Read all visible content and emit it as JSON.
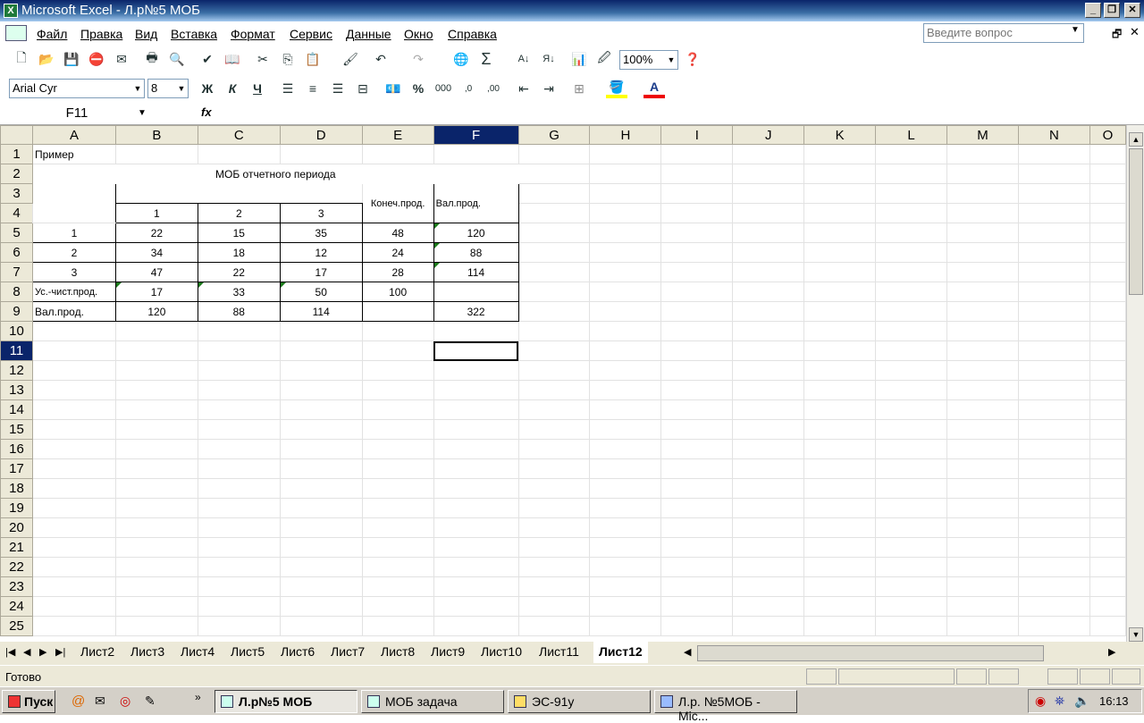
{
  "window": {
    "title": "Microsoft Excel - Л.р№5 МОБ"
  },
  "menu": {
    "items": [
      "Файл",
      "Правка",
      "Вид",
      "Вставка",
      "Формат",
      "Сервис",
      "Данные",
      "Окно",
      "Справка"
    ],
    "ask_placeholder": "Введите вопрос"
  },
  "toolbar": {
    "zoom": "100%",
    "font": "Arial Cyr",
    "size": "8",
    "bold": "Ж",
    "italic": "К",
    "underline": "Ч"
  },
  "formula": {
    "name_box": "F11",
    "fx": "fx",
    "content": ""
  },
  "columns": [
    "A",
    "B",
    "C",
    "D",
    "E",
    "F",
    "G",
    "H",
    "I",
    "J",
    "K",
    "L",
    "M",
    "N",
    "O"
  ],
  "rows": [
    "1",
    "2",
    "3",
    "4",
    "5",
    "6",
    "7",
    "8",
    "9",
    "10",
    "11",
    "12",
    "13",
    "14",
    "15",
    "16",
    "17",
    "18",
    "19",
    "20",
    "21",
    "22",
    "23",
    "24",
    "25"
  ],
  "cells": {
    "A1": "Пример",
    "title": "МОБ отчетного периода",
    "E3": "Конеч.прод.",
    "F3": "Вал.прод.",
    "B4": "1",
    "C4": "2",
    "D4": "3",
    "A5": "1",
    "B5": "22",
    "C5": "15",
    "D5": "35",
    "E5": "48",
    "F5": "120",
    "A6": "2",
    "B6": "34",
    "C6": "18",
    "D6": "12",
    "E6": "24",
    "F6": "88",
    "A7": "3",
    "B7": "47",
    "C7": "22",
    "D7": "17",
    "E7": "28",
    "F7": "114",
    "A8": "Ус.-чист.прод.",
    "B8": "17",
    "C8": "33",
    "D8": "50",
    "E8": "100",
    "A9": "Вал.прод.",
    "B9": "120",
    "C9": "88",
    "D9": "114",
    "F9": "322"
  },
  "sheets": [
    "Лист2",
    "Лист3",
    "Лист4",
    "Лист5",
    "Лист6",
    "Лист7",
    "Лист8",
    "Лист9",
    "Лист10",
    "Лист11",
    "Лист12"
  ],
  "active_sheet": "Лист12",
  "status": {
    "text": "Готово"
  },
  "taskbar": {
    "start": "Пуск",
    "tasks": [
      "Л.р№5 МОБ",
      "МОБ задача",
      "ЭС-91у",
      "Л.р. №5МОБ - Mic..."
    ],
    "clock": "16:13"
  }
}
